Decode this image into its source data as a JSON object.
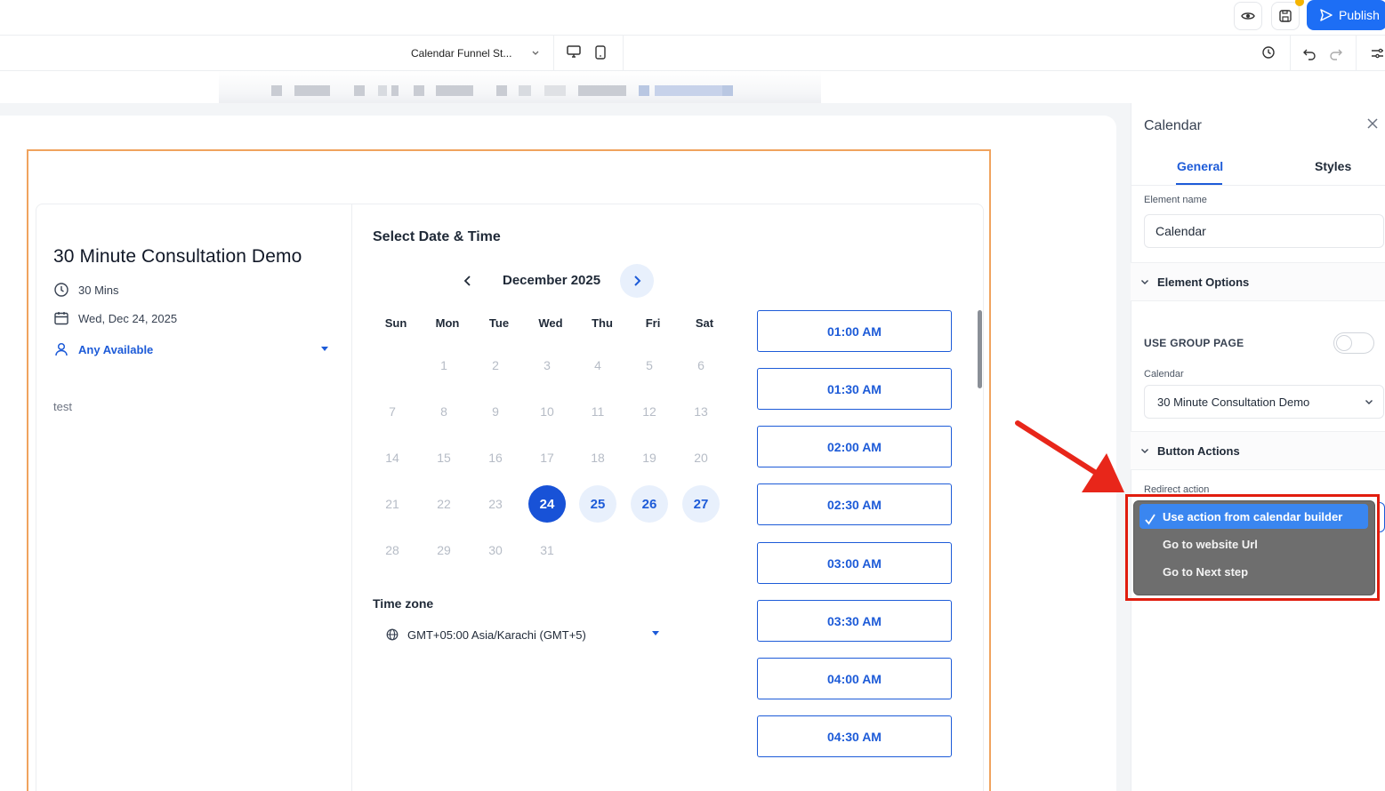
{
  "toolbar": {
    "publish_label": "Publish",
    "page_selector": "Calendar Funnel St...",
    "icons": [
      "eye-icon",
      "save-icon",
      "desktop-icon",
      "mobile-icon",
      "history-icon",
      "undo-icon",
      "redo-icon",
      "settings-icon"
    ]
  },
  "event": {
    "title": "30 Minute Consultation Demo",
    "duration": "30 Mins",
    "date": "Wed, Dec 24, 2025",
    "staff": "Any Available",
    "description": "test"
  },
  "calendar": {
    "heading": "Select Date & Time",
    "month": "December 2025",
    "weekdays": [
      "Sun",
      "Mon",
      "Tue",
      "Wed",
      "Thu",
      "Fri",
      "Sat"
    ],
    "days": [
      "1",
      "2",
      "3",
      "4",
      "5",
      "6",
      "7",
      "8",
      "9",
      "10",
      "11",
      "12",
      "13",
      "14",
      "15",
      "16",
      "17",
      "18",
      "19",
      "20",
      "21",
      "22",
      "23",
      "24",
      "25",
      "26",
      "27",
      "28",
      "29",
      "30",
      "31"
    ],
    "selected_day": "24",
    "available_days": [
      "25",
      "26",
      "27"
    ],
    "timezone_label": "Time zone",
    "timezone_value": "GMT+05:00 Asia/Karachi (GMT+5)"
  },
  "slots": [
    "01:00 AM",
    "01:30 AM",
    "02:00 AM",
    "02:30 AM",
    "03:00 AM",
    "03:30 AM",
    "04:00 AM",
    "04:30 AM"
  ],
  "panel": {
    "title": "Calendar",
    "tabs": [
      "General",
      "Styles"
    ],
    "element_name_label": "Element name",
    "element_name_value": "Calendar",
    "element_options": "Element Options",
    "use_group_page": "USE GROUP PAGE",
    "calendar_label": "Calendar",
    "calendar_value": "30 Minute Consultation Demo",
    "button_actions": "Button Actions",
    "redirect_label": "Redirect action",
    "dropdown_options": [
      "Use action from calendar builder",
      "Go to website Url",
      "Go to Next step"
    ]
  },
  "colors": {
    "accent": "#1d5bd8",
    "publish": "#1d6ef5",
    "selection_frame": "#f0a35e",
    "highlight": "#e11d0e"
  }
}
